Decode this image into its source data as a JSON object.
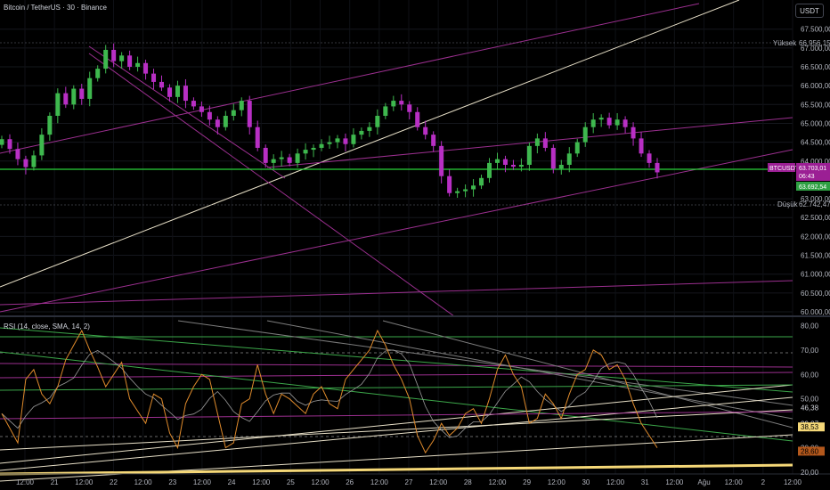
{
  "header": {
    "title": "Bitcoin / TetherUS · 30 · Binance",
    "currency": "USDT"
  },
  "price_panel": {
    "high_label": "Yüksek",
    "high_value": "66.956,15",
    "low_label": "Düşük",
    "low_value": "62.742,47",
    "symbol_tag": "BTCUSDT",
    "last_price": "63.703,01",
    "countdown": "06:43",
    "second_tag": "63.692,54"
  },
  "rsi_panel": {
    "title": "RSI (14, close, SMA, 14, 2)",
    "tags": [
      "46,38",
      "39,87",
      "38,53",
      "28,60"
    ]
  },
  "x_axis_labels": [
    "12:00",
    "21",
    "12:00",
    "22",
    "12:00",
    "23",
    "12:00",
    "24",
    "12:00",
    "25",
    "12:00",
    "26",
    "12:00",
    "27",
    "12:00",
    "28",
    "12:00",
    "29",
    "12:00",
    "30",
    "12:00",
    "31",
    "12:00",
    "Ağu",
    "12:00",
    "2",
    "12:00"
  ],
  "colors": {
    "bull": "#3eb84e",
    "bear": "#b82fc4",
    "green_line": "#2ad33a",
    "rsi_line": "#e08b2c",
    "rsi_ma": "#9a9a9a",
    "purple_line": "#9b2f8f",
    "beige_line": "#e8e0c8"
  },
  "chart_data": [
    {
      "type": "candlestick",
      "title": "Bitcoin / TetherUS · 30 · Binance",
      "ylabel": "USDT",
      "ylim": [
        60000,
        67800
      ],
      "y_ticks": [
        "67.500,00",
        "67.000,00",
        "66.500,00",
        "66.000,00",
        "65.500,00",
        "65.000,00",
        "64.500,00",
        "64.000,00",
        "63.000,00",
        "62.500,00",
        "62.000,00",
        "61.500,00",
        "61.000,00",
        "60.500,00",
        "60.000,00"
      ],
      "x": [
        "12:00",
        "21",
        "12:00",
        "22",
        "12:00",
        "23",
        "12:00",
        "24",
        "12:00",
        "25",
        "12:00",
        "26",
        "12:00",
        "27",
        "12:00",
        "28",
        "12:00",
        "29",
        "12:00",
        "30",
        "12:00",
        "31",
        "12:00"
      ],
      "series": [
        {
          "close": [
            64580,
            64320,
            64050,
            63840,
            64150,
            64700,
            65200,
            65800,
            65500,
            65920,
            65650,
            66200,
            66450,
            66950,
            66650,
            66800,
            66500,
            66600,
            66320,
            66100,
            65950,
            65700,
            66000,
            65600,
            65450,
            65300,
            65100,
            64900,
            65200,
            65350,
            65600,
            64900,
            64350,
            63950,
            64050,
            64100,
            63950,
            64200,
            64300,
            64350,
            64450,
            64500,
            64600,
            64450,
            64700,
            64800,
            64900,
            65200,
            65450,
            65600,
            65500,
            65300,
            64900,
            64700,
            64400,
            63600,
            63150,
            63200,
            63250,
            63350,
            63550,
            63950,
            64050,
            63900,
            63850,
            63900,
            64400,
            64600,
            64350,
            63800,
            63900,
            64200,
            64500,
            64900,
            65100,
            65150,
            64950,
            65100,
            64900,
            64600,
            64200,
            63950,
            63700
          ]
        }
      ],
      "annotations": {
        "high": 66956.15,
        "low": 62742.47,
        "last": 63703.01,
        "second_tag": 63692.54
      }
    },
    {
      "type": "line",
      "title": "RSI (14, close, SMA, 14, 2)",
      "ylim": [
        20,
        82
      ],
      "y_ticks": [
        "80,00",
        "70,00",
        "60,00",
        "50,00",
        "40,00",
        "30,00",
        "20,00"
      ],
      "series": [
        {
          "name": "RSI",
          "values": [
            44,
            38,
            32,
            58,
            62,
            52,
            48,
            55,
            66,
            72,
            78,
            70,
            63,
            55,
            60,
            65,
            50,
            45,
            40,
            52,
            50,
            36,
            30,
            48,
            55,
            60,
            58,
            44,
            30,
            32,
            48,
            50,
            64,
            52,
            44,
            52,
            50,
            47,
            44,
            52,
            55,
            48,
            46,
            58,
            62,
            66,
            70,
            78,
            72,
            64,
            58,
            50,
            35,
            28,
            33,
            40,
            35,
            38,
            44,
            46,
            40,
            50,
            62,
            68,
            60,
            55,
            40,
            42,
            52,
            48,
            42,
            52,
            60,
            62,
            70,
            68,
            62,
            64,
            58,
            48,
            40,
            35,
            30
          ]
        }
      ],
      "tags": [
        46.38,
        39.87,
        38.53,
        28.6
      ]
    }
  ]
}
